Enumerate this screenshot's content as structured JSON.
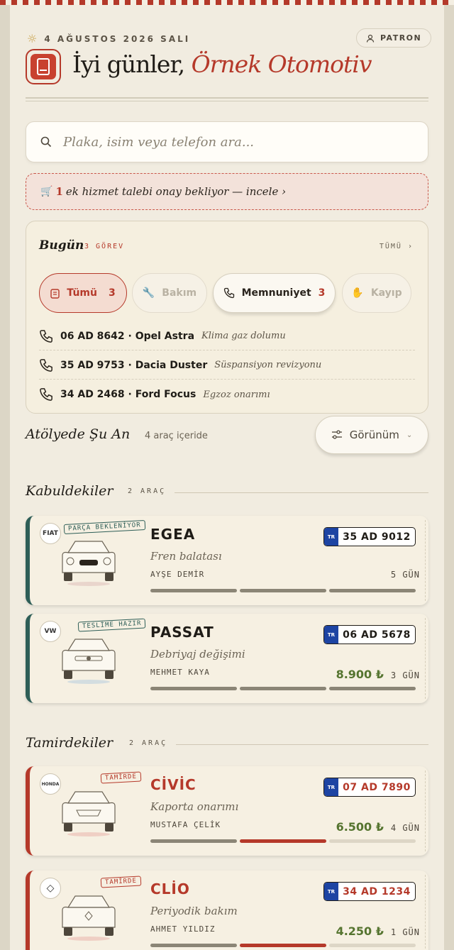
{
  "header": {
    "date": "4 AĞUSTOS 2026 SALI",
    "role_badge": "PATRON",
    "greeting": "İyi günler,",
    "business_name": "Örnek Otomotiv"
  },
  "search": {
    "placeholder": "Plaka, isim veya telefon ara..."
  },
  "alert": {
    "count": "1",
    "text": "ek hizmet talebi onay bekliyor — incele ›"
  },
  "today": {
    "title": "Bugün",
    "count_label": "3 GÖREV",
    "all_link": "TÜMÜ ›",
    "filters": [
      {
        "label": "Tümü",
        "count": "3",
        "icon": "clipboard-icon",
        "state": "active"
      },
      {
        "label": "Bakım",
        "icon": "wrench-icon",
        "state": "off"
      },
      {
        "label": "Memnuniyet",
        "count": "3",
        "icon": "phone-icon",
        "state": "mid"
      },
      {
        "label": "Kayıp",
        "icon": "hand-icon",
        "state": "off"
      }
    ],
    "tasks": [
      {
        "plate_car": "06 AD 8642 · Opel Astra",
        "desc": "Klima gaz dolumu"
      },
      {
        "plate_car": "35 AD 9753 · Dacia Duster",
        "desc": "Süspansiyon revizyonu"
      },
      {
        "plate_car": "34 AD 2468 · Ford Focus",
        "desc": "Egzoz onarımı"
      }
    ]
  },
  "workshop": {
    "title": "Atölyede Şu An",
    "count": "4 araç içeride",
    "view_button": "Görünüm"
  },
  "sections": [
    {
      "title": "Kabuldekiler",
      "count": "2 ARAÇ",
      "vehicles": [
        {
          "brand": "FIAT",
          "stamp": "PARÇA BEKLENİYOR",
          "model": "EGEA",
          "job": "Fren balatası",
          "owner": "AYŞE DEMİR",
          "plate_prefix": "TR",
          "plate": "35 AD 9012",
          "price": "",
          "days": "5 GÜN",
          "progress": "3 of 3 steps"
        },
        {
          "brand": "VW",
          "stamp": "TESLİME HAZIR",
          "model": "PASSAT",
          "job": "Debriyaj değişimi",
          "owner": "MEHMET KAYA",
          "plate_prefix": "TR",
          "plate": "06 AD 5678",
          "price": "8.900 ₺",
          "days": "3 GÜN",
          "progress": "3 of 3 steps"
        }
      ]
    },
    {
      "title": "Tamirdekiler",
      "count": "2 ARAÇ",
      "vehicles": [
        {
          "brand": "HONDA",
          "stamp": "TAMİRDE",
          "model": "CİVİC",
          "job": "Kaporta onarımı",
          "owner": "MUSTAFA ÇELİK",
          "plate_prefix": "TR",
          "plate": "07 AD 7890",
          "price": "6.500 ₺",
          "days": "4 GÜN",
          "progress": "2 of 3 steps"
        },
        {
          "brand": "RENAULT",
          "stamp": "TAMİRDE",
          "model": "CLİO",
          "job": "Periyodik bakım",
          "owner": "AHMET YILDIZ",
          "plate_prefix": "TR",
          "plate": "34 AD 1234",
          "price": "4.250 ₺",
          "days": "1 GÜN",
          "progress": "2 of 3 steps"
        }
      ]
    }
  ],
  "colors": {
    "accent": "#b5392a",
    "teal": "#2e5e57",
    "price": "#55742f",
    "background": "#f1ece0"
  }
}
